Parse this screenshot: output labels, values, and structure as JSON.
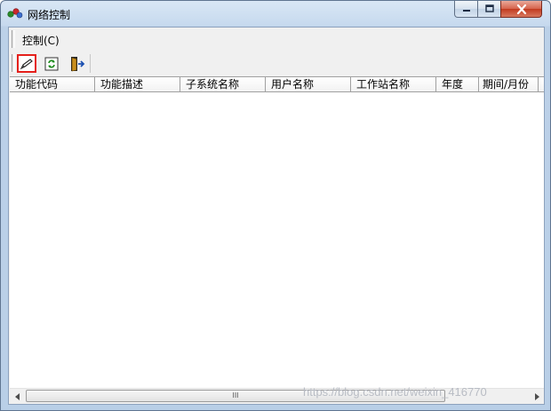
{
  "window": {
    "title": "网络控制"
  },
  "menu": {
    "items": [
      {
        "label": "控制(C)"
      }
    ]
  },
  "toolbar": {
    "tools": [
      {
        "icon": "edit-pen-icon",
        "selected": true
      },
      {
        "icon": "refresh-icon",
        "selected": false
      },
      {
        "icon": "exit-door-icon",
        "selected": false
      }
    ]
  },
  "grid": {
    "columns": [
      "功能代码",
      "功能描述",
      "子系统名称",
      "用户名称",
      "工作站名称",
      "年度",
      "期间/月份"
    ],
    "rows": []
  },
  "scrollbar": {
    "grip": "III"
  },
  "watermark": "https://blog.csdn.net/weixin_416770",
  "colors": {
    "selection_border": "#e5201b",
    "close_button": "#c23b20",
    "title_bar": "#c6d9ee"
  }
}
